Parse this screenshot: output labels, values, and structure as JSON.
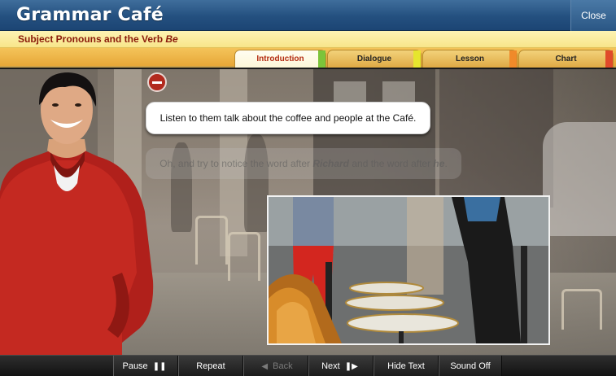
{
  "app": {
    "title": "Grammar Café",
    "close_label": "Close"
  },
  "lesson": {
    "subtitle_prefix": "Subject Pronouns and the Verb ",
    "subtitle_emphasis": "Be"
  },
  "tabs": [
    {
      "label": "Introduction",
      "active": true,
      "marker_color": "#7cc43a"
    },
    {
      "label": "Dialogue",
      "active": false,
      "marker_color": "#e6e62e"
    },
    {
      "label": "Lesson",
      "active": false,
      "marker_color": "#f08a2a"
    },
    {
      "label": "Chart",
      "active": false,
      "marker_color": "#e04a2a"
    }
  ],
  "stage": {
    "bubble_text": "Listen to them talk about the coffee and people at the Café.",
    "faded_part1": "Oh, and try to notice the word after ",
    "faded_em1": "Richard",
    "faded_part2": " and the word after ",
    "faded_em2": "he",
    "faded_end": "."
  },
  "toolbar": {
    "pause_label": "Pause",
    "pause_icon": "pause-icon",
    "repeat_label": "Repeat",
    "back_label": "Back",
    "back_icon": "step-back-icon",
    "next_label": "Next",
    "next_icon": "step-forward-icon",
    "hide_text_label": "Hide Text",
    "sound_off_label": "Sound Off"
  }
}
